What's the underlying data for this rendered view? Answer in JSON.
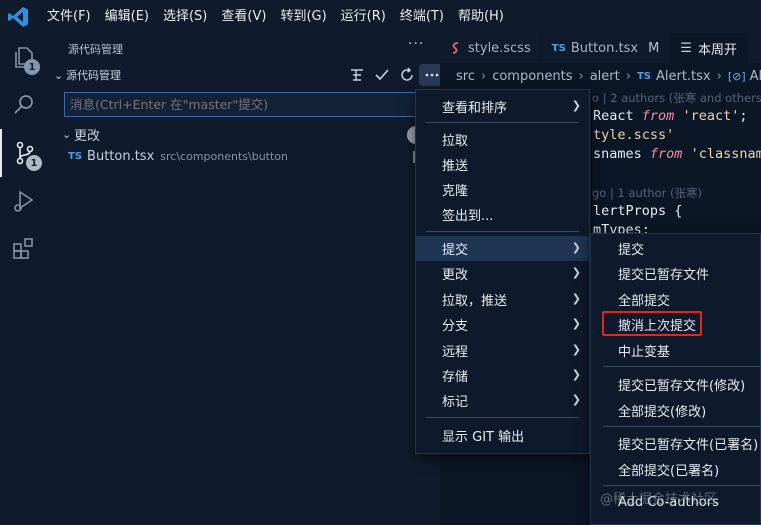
{
  "menubar": [
    "文件(F)",
    "编辑(E)",
    "选择(S)",
    "查看(V)",
    "转到(G)",
    "运行(R)",
    "终端(T)",
    "帮助(H)"
  ],
  "activity": {
    "explorer_badge": "1",
    "scm_badge": "1"
  },
  "sidebar": {
    "title": "源代码管理",
    "more": "···",
    "section_title": "源代码管理",
    "commit_placeholder": "消息(Ctrl+Enter 在\"master\"提交)",
    "changes_label": "更改",
    "file": {
      "lang": "TS",
      "name": "Button.tsx",
      "path": "src\\components\\button"
    }
  },
  "tabs": [
    {
      "label": "style.scss",
      "lang": ""
    },
    {
      "label": "Button.tsx",
      "lang": "TS",
      "status": "M"
    },
    {
      "label": "本周开",
      "lang": ""
    }
  ],
  "breadcrumb": {
    "p1": "src",
    "p2": "components",
    "p3": "alert",
    "lang": "TS",
    "file": "Alert.tsx",
    "symbol": "Alert"
  },
  "code": {
    "blame1": "o | 2 authors (张寒 and others)",
    "l1_a": " React ",
    "l1_kw": "from",
    "l1_str": "'react'",
    "l1_end": ";",
    "l2_str": "tyle.scss'",
    "l3_a": "snames ",
    "l3_kw": "from",
    "l3_str": "'classname",
    "blame2": "go | 1 author (张寒)",
    "l4": "lertProps {",
    "l5": "mTypes;"
  },
  "main_menu": {
    "view_sort": "查看和排序",
    "pull": "拉取",
    "push": "推送",
    "clone": "克隆",
    "checkout": "签出到...",
    "commit": "提交",
    "changes": "更改",
    "pull_push": "拉取，推送",
    "branch": "分支",
    "remote": "远程",
    "stash": "存储",
    "tags": "标记",
    "show_git_output": "显示 GIT 输出"
  },
  "commit_submenu": {
    "commit": "提交",
    "commit_staged": "提交已暂存文件",
    "commit_all": "全部提交",
    "undo_last": "撤消上次提交",
    "abort_rebase": "中止变基",
    "commit_staged_amend": "提交已暂存文件(修改)",
    "commit_all_amend": "全部提交(修改)",
    "commit_staged_signed": "提交已暂存文件(已署名)",
    "commit_all_signed": "全部提交(已署名)",
    "add_coauthors": "Add Co-authors"
  },
  "watermark": "@稀土掘金技术社区",
  "colors": {
    "accent": "#3d6aa6",
    "highlight_box": "#e0281f",
    "ts": "#4e9fe8"
  }
}
